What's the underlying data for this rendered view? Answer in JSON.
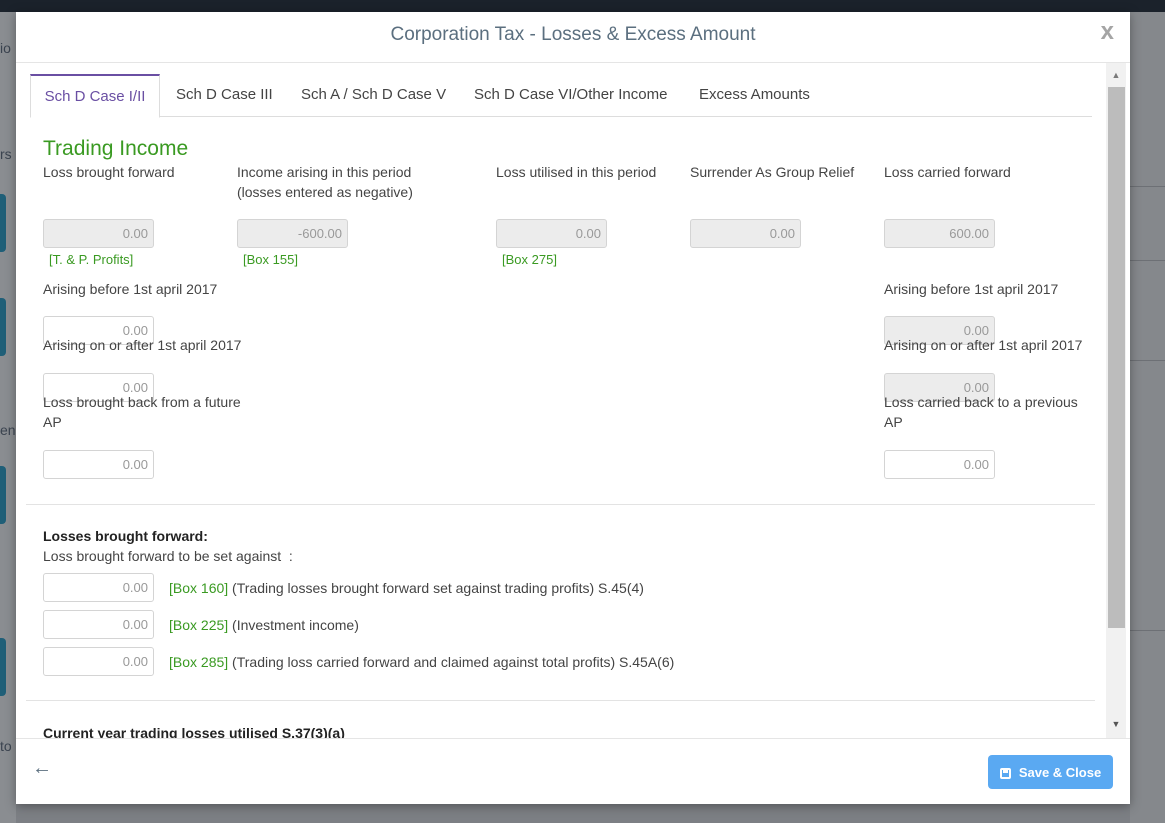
{
  "background": {
    "fragments": [
      "io",
      "rs",
      "en",
      "to"
    ]
  },
  "modal": {
    "title": "Corporation Tax - Losses & Excess Amount",
    "close_glyph": "x",
    "tabs": [
      {
        "label": "Sch D Case I/II",
        "active": true
      },
      {
        "label": "Sch D Case III",
        "active": false
      },
      {
        "label": "Sch A / Sch D Case V",
        "active": false
      },
      {
        "label": "Sch D Case VI/Other Income",
        "active": false
      },
      {
        "label": "Excess Amounts",
        "active": false
      }
    ],
    "trading": {
      "title": "Trading Income",
      "loss_bf": {
        "label": "Loss brought forward",
        "value": "0.00",
        "box": "[T. & P. Profits]"
      },
      "income_arising": {
        "label_line1": "Income arising in this period",
        "label_line2": "(losses entered as negative)",
        "value": "-600.00",
        "box": "[Box 155]"
      },
      "loss_utilised": {
        "label": "Loss utilised in this period",
        "value": "0.00",
        "box": "[Box 275]"
      },
      "surrender": {
        "label": "Surrender As Group Relief",
        "value": "0.00"
      },
      "loss_cf": {
        "label": "Loss carried forward",
        "value": "600.00"
      },
      "left": {
        "before_2017": {
          "label": "Arising before 1st april 2017",
          "value": "0.00"
        },
        "after_2017": {
          "label": "Arising on or after 1st april 2017",
          "value": "0.00"
        },
        "brought_back": {
          "label_line1": "Loss brought back from a future",
          "label_line2": "AP",
          "value": "0.00"
        }
      },
      "right": {
        "before_2017": {
          "label": "Arising before 1st april 2017",
          "value": "0.00"
        },
        "after_2017": {
          "label": "Arising on or after 1st april 2017",
          "value": "0.00"
        },
        "carried_back": {
          "label_line1": "Loss carried back to a previous",
          "label_line2": "AP",
          "value": "0.00"
        }
      }
    },
    "losses_bf": {
      "heading": "Losses brought forward:",
      "subheading": "Loss brought forward to be set against  :",
      "rows": [
        {
          "value": "0.00",
          "box": "[Box 160]",
          "text": "(Trading losses brought forward set against trading profits) S.45(4)"
        },
        {
          "value": "0.00",
          "box": "[Box 225]",
          "text": "(Investment income)"
        },
        {
          "value": "0.00",
          "box": "[Box 285]",
          "text": "(Trading loss carried forward and claimed against total profits) S.45A(6)"
        }
      ]
    },
    "current_year": {
      "heading": "Current year trading losses utilised S.37(3)(a)"
    },
    "footer": {
      "back_glyph": "🡠",
      "save_label": "Save & Close"
    }
  }
}
